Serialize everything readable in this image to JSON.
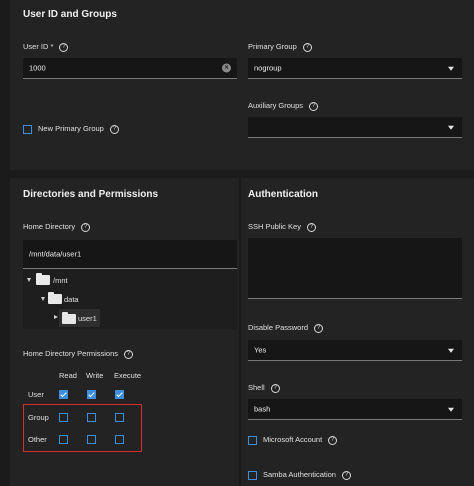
{
  "user_section": {
    "title": "User ID and Groups",
    "user_id_label": "User ID *",
    "user_id_value": "1000",
    "primary_group_label": "Primary Group",
    "primary_group_value": "nogroup",
    "aux_groups_label": "Auxiliary Groups",
    "aux_groups_value": "",
    "new_primary_group_label": "New Primary Group"
  },
  "dirs_section": {
    "title": "Directories and Permissions",
    "home_dir_label": "Home Directory",
    "home_dir_value": "/mnt/data/user1",
    "tree": [
      {
        "name": "/mnt"
      },
      {
        "name": "data"
      },
      {
        "name": "user1"
      }
    ],
    "permissions_label": "Home Directory Permissions",
    "columns": [
      "Read",
      "Write",
      "Execute"
    ],
    "rows": [
      {
        "name": "User",
        "values": [
          true,
          true,
          true
        ]
      },
      {
        "name": "Group",
        "values": [
          false,
          false,
          false
        ]
      },
      {
        "name": "Other",
        "values": [
          false,
          false,
          false
        ]
      }
    ]
  },
  "auth_section": {
    "title": "Authentication",
    "ssh_key_label": "SSH Public Key",
    "ssh_key_value": "",
    "disable_password_label": "Disable Password",
    "disable_password_value": "Yes",
    "shell_label": "Shell",
    "shell_value": "bash",
    "microsoft_account_label": "Microsoft Account",
    "samba_auth_label": "Samba Authentication"
  },
  "help_glyph": "?",
  "clear_glyph": "×",
  "colors": {
    "background": "#1b1b1b",
    "panel": "#232323",
    "accent": "#3e8ede",
    "highlight_box": "#d62c2c"
  }
}
